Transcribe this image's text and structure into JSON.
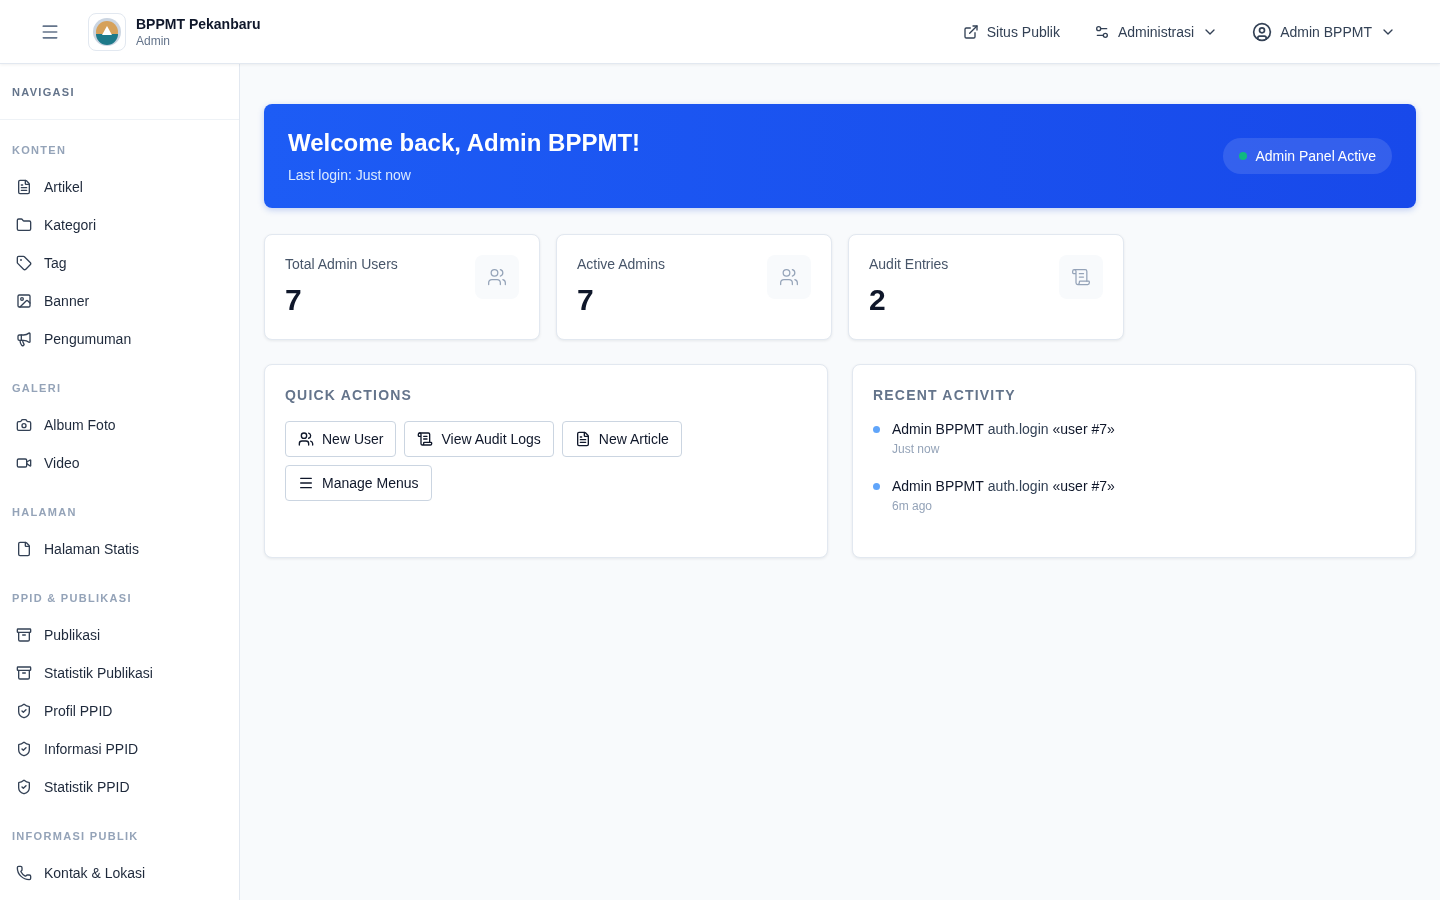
{
  "header": {
    "title": "BPPMT Pekanbaru",
    "subtitle": "Admin",
    "links": [
      {
        "label": "Situs Publik",
        "kind": "link"
      },
      {
        "label": "Administrasi",
        "kind": "dropdown"
      },
      {
        "label": "Admin BPPMT",
        "kind": "user"
      }
    ]
  },
  "sidebar": {
    "heading": "NAVIGASI",
    "sections": [
      {
        "title": "KONTEN",
        "items": [
          {
            "label": "Artikel",
            "selected": false
          },
          {
            "label": "Kategori",
            "selected": false
          },
          {
            "label": "Tag",
            "selected": false
          },
          {
            "label": "Banner",
            "selected": false
          },
          {
            "label": "Pengumuman",
            "selected": false
          }
        ]
      },
      {
        "title": "GALERI",
        "items": [
          {
            "label": "Album Foto",
            "selected": false
          },
          {
            "label": "Video",
            "selected": false
          }
        ]
      },
      {
        "title": "HALAMAN",
        "items": [
          {
            "label": "Halaman Statis",
            "selected": false
          }
        ]
      },
      {
        "title": "PPID & PUBLIKASI",
        "items": [
          {
            "label": "Publikasi",
            "selected": false
          },
          {
            "label": "Statistik Publikasi",
            "selected": false
          },
          {
            "label": "Profil PPID",
            "selected": false
          },
          {
            "label": "Informasi PPID",
            "selected": false
          },
          {
            "label": "Statistik PPID",
            "selected": false
          }
        ]
      },
      {
        "title": "INFORMASI PUBLIK",
        "items": [
          {
            "label": "Kontak & Lokasi",
            "selected": false
          }
        ]
      }
    ]
  },
  "welcome": {
    "title": "Welcome back, Admin BPPMT!",
    "subtitle": "Last login: Just now",
    "badge": {
      "label": "Admin Panel Active",
      "color": "#10b981"
    }
  },
  "stats": [
    {
      "label": "Total Admin Users",
      "value": "7"
    },
    {
      "label": "Active Admins",
      "value": "7"
    },
    {
      "label": "Audit Entries",
      "value": "2"
    }
  ],
  "quick_actions": {
    "title": "QUICK ACTIONS",
    "buttons": [
      "New User",
      "View Audit Logs",
      "New Article",
      "Manage Menus"
    ]
  },
  "recent_activity": {
    "title": "RECENT ACTIVITY",
    "items": [
      {
        "actor": "Admin BPPMT",
        "action": "auth.login",
        "target": "«user #7»",
        "time": "Just now",
        "color": "#60a5fa"
      },
      {
        "actor": "Admin BPPMT",
        "action": "auth.login",
        "target": "«user #7»",
        "time": "6m ago",
        "color": "#60a5fa"
      }
    ]
  }
}
